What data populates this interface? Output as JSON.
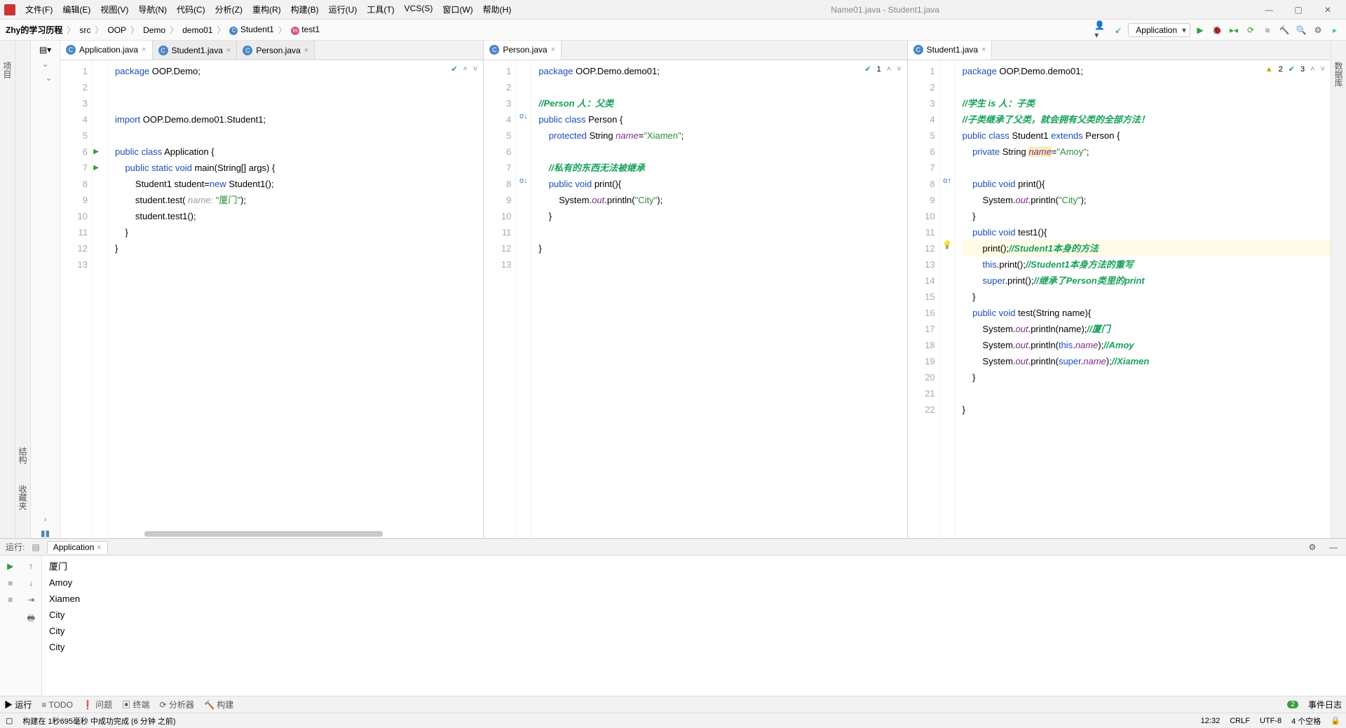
{
  "window_title": "Name01.java - Student1.java",
  "menu": [
    "文件(F)",
    "编辑(E)",
    "视图(V)",
    "导航(N)",
    "代码(C)",
    "分析(Z)",
    "重构(R)",
    "构建(B)",
    "运行(U)",
    "工具(T)",
    "VCS(S)",
    "窗口(W)",
    "帮助(H)"
  ],
  "breadcrumbs": [
    "Zhy的学习历程",
    "src",
    "OOP",
    "Demo",
    "demo01",
    "Student1",
    "test1"
  ],
  "run_config": "Application",
  "left_rail_label": "项目",
  "right_rail_label": "数据库",
  "struct_labels": [
    "结构",
    "收藏夹"
  ],
  "panes": [
    {
      "tabs": [
        {
          "label": "Application.java",
          "active": true
        },
        {
          "label": "Student1.java",
          "active": false
        },
        {
          "label": "Person.java",
          "active": false
        }
      ],
      "inspection": {
        "check": true
      },
      "gutter_runs": [
        6,
        7
      ],
      "lines": [
        [
          {
            "t": "package ",
            "c": "kw"
          },
          {
            "t": "OOP.Demo;"
          }
        ],
        [
          {
            "t": ""
          }
        ],
        [
          {
            "t": ""
          }
        ],
        [
          {
            "t": "import ",
            "c": "kw"
          },
          {
            "t": "OOP.Demo.demo01.Student1;"
          }
        ],
        [
          {
            "t": ""
          }
        ],
        [
          {
            "t": "public class ",
            "c": "kw"
          },
          {
            "t": "Application {"
          }
        ],
        [
          {
            "t": "    public static void ",
            "c": "kw"
          },
          {
            "t": "main",
            "c": ""
          },
          {
            "t": "(String[] args) {"
          }
        ],
        [
          {
            "t": "        Student1 student="
          },
          {
            "t": "new ",
            "c": "kw"
          },
          {
            "t": "Student1();"
          }
        ],
        [
          {
            "t": "        student.test( "
          },
          {
            "t": "name: ",
            "c": "cm"
          },
          {
            "t": "\"厦门\"",
            "c": "str"
          },
          {
            "t": ");"
          }
        ],
        [
          {
            "t": "        student.test1();"
          }
        ],
        [
          {
            "t": "    }"
          }
        ],
        [
          {
            "t": "}"
          }
        ],
        [
          {
            "t": ""
          }
        ]
      ]
    },
    {
      "tabs": [
        {
          "label": "Person.java",
          "active": true
        }
      ],
      "inspection": {
        "check": true,
        "count": "1"
      },
      "gutter_marks": {
        "4": "o↓",
        "8": "o↓"
      },
      "lines": [
        [
          {
            "t": "package ",
            "c": "kw"
          },
          {
            "t": "OOP.Demo.demo01;"
          }
        ],
        [
          {
            "t": ""
          }
        ],
        [
          {
            "t": "//Person 人：父类",
            "c": "cmz"
          }
        ],
        [
          {
            "t": "public class ",
            "c": "kw"
          },
          {
            "t": "Person {"
          }
        ],
        [
          {
            "t": "    protected ",
            "c": "kw"
          },
          {
            "t": "String "
          },
          {
            "t": "name",
            "c": "fld"
          },
          {
            "t": "="
          },
          {
            "t": "\"Xiamen\"",
            "c": "str"
          },
          {
            "t": ";"
          }
        ],
        [
          {
            "t": ""
          }
        ],
        [
          {
            "t": "    //私有的东西无法被继承",
            "c": "cmz"
          }
        ],
        [
          {
            "t": "    public void ",
            "c": "kw"
          },
          {
            "t": "print(){"
          }
        ],
        [
          {
            "t": "        System."
          },
          {
            "t": "out",
            "c": "fld"
          },
          {
            "t": ".println("
          },
          {
            "t": "\"City\"",
            "c": "str"
          },
          {
            "t": ");"
          }
        ],
        [
          {
            "t": "    }"
          }
        ],
        [
          {
            "t": ""
          }
        ],
        [
          {
            "t": "}"
          }
        ],
        [
          {
            "t": ""
          }
        ]
      ]
    },
    {
      "tabs": [
        {
          "label": "Student1.java",
          "active": true
        }
      ],
      "inspection": {
        "warn": "2",
        "check_n": "3"
      },
      "gutter_marks": {
        "8": "o↑"
      },
      "bulb_line": 12,
      "highlight": 12,
      "lines": [
        [
          {
            "t": "package ",
            "c": "kw"
          },
          {
            "t": "OOP.Demo.demo01;"
          }
        ],
        [
          {
            "t": ""
          }
        ],
        [
          {
            "t": "//学生 is 人：子类",
            "c": "cmz"
          }
        ],
        [
          {
            "t": "//子类继承了父类，就会拥有父类的全部方法！",
            "c": "cmz"
          }
        ],
        [
          {
            "t": "public class ",
            "c": "kw"
          },
          {
            "t": "Student1 "
          },
          {
            "t": "extends ",
            "c": "kw"
          },
          {
            "t": "Person {"
          }
        ],
        [
          {
            "t": "    private ",
            "c": "kw"
          },
          {
            "t": "String "
          },
          {
            "t": "name",
            "c": "fld warn"
          },
          {
            "t": "="
          },
          {
            "t": "\"Amoy\"",
            "c": "str"
          },
          {
            "t": ";"
          }
        ],
        [
          {
            "t": ""
          }
        ],
        [
          {
            "t": "    public void ",
            "c": "kw"
          },
          {
            "t": "print(){"
          }
        ],
        [
          {
            "t": "        System."
          },
          {
            "t": "out",
            "c": "fld"
          },
          {
            "t": ".println("
          },
          {
            "t": "\"City\"",
            "c": "str"
          },
          {
            "t": ");"
          }
        ],
        [
          {
            "t": "    }"
          }
        ],
        [
          {
            "t": "    public void ",
            "c": "kw"
          },
          {
            "t": "test1(){"
          }
        ],
        [
          {
            "t": "        print();"
          },
          {
            "t": "//Student1本身的方法",
            "c": "cmz"
          }
        ],
        [
          {
            "t": "        this",
            "c": "kw"
          },
          {
            "t": ".print();"
          },
          {
            "t": "//Student1本身方法的重写",
            "c": "cmz"
          }
        ],
        [
          {
            "t": "        super",
            "c": "kw"
          },
          {
            "t": ".print();"
          },
          {
            "t": "//继承了Person类里的print",
            "c": "cmz"
          }
        ],
        [
          {
            "t": "    }"
          }
        ],
        [
          {
            "t": "    public void ",
            "c": "kw"
          },
          {
            "t": "test(String name){"
          }
        ],
        [
          {
            "t": "        System."
          },
          {
            "t": "out",
            "c": "fld"
          },
          {
            "t": ".println(name);"
          },
          {
            "t": "//厦门",
            "c": "cmz"
          }
        ],
        [
          {
            "t": "        System."
          },
          {
            "t": "out",
            "c": "fld"
          },
          {
            "t": ".println("
          },
          {
            "t": "this",
            "c": "kw"
          },
          {
            "t": "."
          },
          {
            "t": "name",
            "c": "fld"
          },
          {
            "t": ");"
          },
          {
            "t": "//Amoy",
            "c": "cmz"
          }
        ],
        [
          {
            "t": "        System."
          },
          {
            "t": "out",
            "c": "fld"
          },
          {
            "t": ".println("
          },
          {
            "t": "super",
            "c": "kw"
          },
          {
            "t": "."
          },
          {
            "t": "name",
            "c": "fld"
          },
          {
            "t": ");"
          },
          {
            "t": "//Xiamen",
            "c": "cmz"
          }
        ],
        [
          {
            "t": "    }"
          }
        ],
        [
          {
            "t": ""
          }
        ],
        [
          {
            "t": "}"
          }
        ]
      ]
    }
  ],
  "tool": {
    "title": "运行:",
    "tab": "Application",
    "output": [
      "厦门",
      "Amoy",
      "Xiamen",
      "City",
      "City",
      "City"
    ]
  },
  "bottom_tabs": [
    "▶ 运行",
    "≡ TODO",
    "❗ 问题",
    "▣ 终端",
    "⟳ 分析器",
    "🔨 构建"
  ],
  "event_log": {
    "count": "2",
    "label": "事件日志"
  },
  "status": {
    "msg": "构建在 1秒695毫秒 中成功完成 (6 分钟 之前)",
    "right": [
      "12:32",
      "CRLF",
      "UTF-8",
      "4 个空格"
    ]
  }
}
